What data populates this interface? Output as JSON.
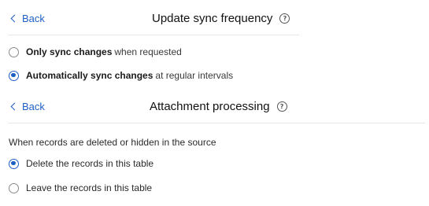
{
  "sync_section": {
    "back_label": "Back",
    "title": "Update sync frequency",
    "help_icon": "question-circle-icon",
    "options": [
      {
        "bold": "Only sync changes",
        "rest": "when requested",
        "selected": false
      },
      {
        "bold": "Automatically sync changes",
        "rest": "at regular intervals",
        "selected": true
      }
    ]
  },
  "attachment_section": {
    "back_label": "Back",
    "title": "Attachment processing",
    "help_icon": "question-circle-icon",
    "question": "When records are deleted or hidden in the source",
    "options": [
      {
        "label": "Delete the records in this table",
        "selected": true
      },
      {
        "label": "Leave the records in this table",
        "selected": false
      }
    ]
  },
  "colors": {
    "accent": "#1f5fc4",
    "divider": "#e6e6e6",
    "text": "#1f1f1f"
  }
}
